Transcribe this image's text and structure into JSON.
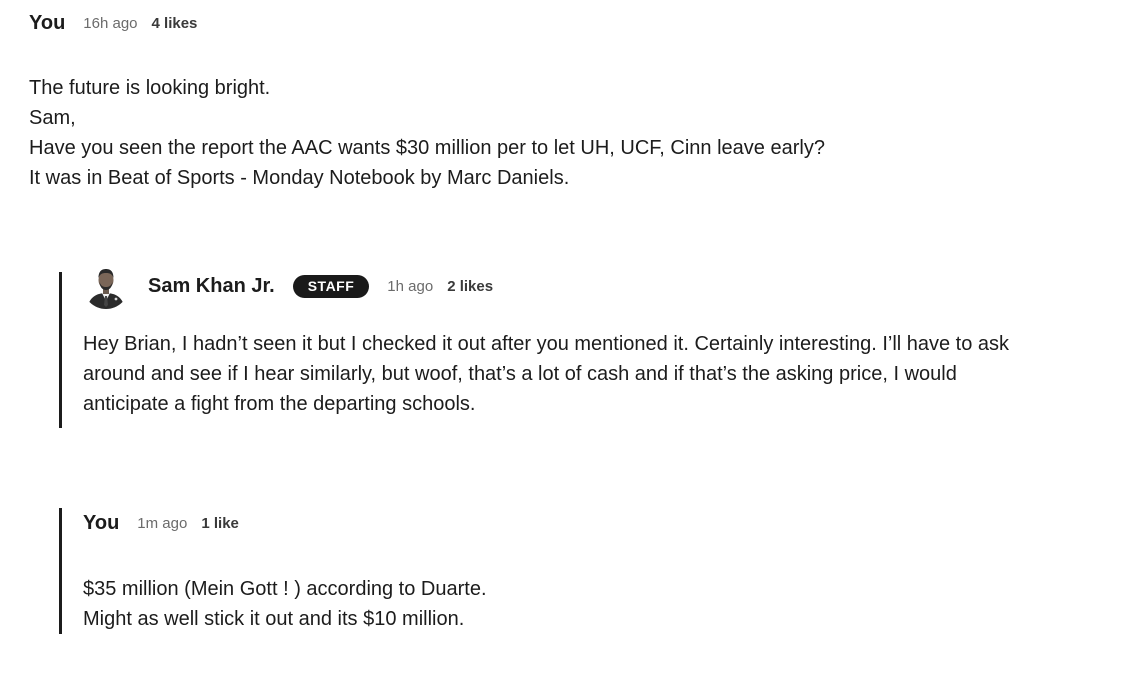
{
  "comments": [
    {
      "author": "You",
      "time": "16h ago",
      "likes": "4 likes",
      "lines": [
        "The future is looking bright.",
        "Sam,",
        "Have you seen the report the AAC wants $30 million per to let UH, UCF, Cinn leave early?",
        "It was in Beat of Sports - Monday Notebook by Marc Daniels."
      ]
    },
    {
      "author": "Sam Khan Jr.",
      "badge": "STAFF",
      "time": "1h ago",
      "likes": "2 likes",
      "lines": [
        "Hey Brian, I hadn’t seen it but I checked it out after you mentioned it. Certainly interesting. I’ll have to ask around and see if I hear similarly, but woof, that’s a lot of cash and if that’s the asking price, I would anticipate a fight from the departing schools."
      ]
    },
    {
      "author": "You",
      "time": "1m ago",
      "likes": "1 like",
      "lines": [
        "$35 million (Mein Gott ! ) according to Duarte.",
        "Might as well stick it out and its $10 million."
      ]
    }
  ],
  "colors": {
    "text": "#1c1c1c",
    "muted": "#6b6b6b",
    "badge_bg": "#1a1a1a",
    "thread_line": "#1c1c1c"
  }
}
